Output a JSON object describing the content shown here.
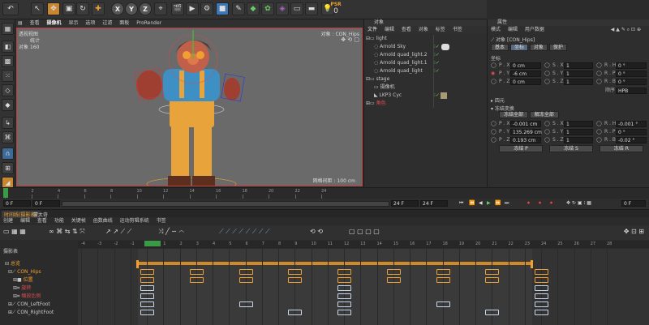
{
  "toolbar": {
    "psr_label": "PSR",
    "psr_value": "0",
    "xyz": [
      "X",
      "Y",
      "Z"
    ]
  },
  "viewport": {
    "menu": [
      "查看",
      "摄像机",
      "显示",
      "选项",
      "过滤",
      "面板",
      "ProRender"
    ],
    "mode_label": "透视视图",
    "stats": {
      "title": "统计",
      "row1_label": "对象",
      "row1_value": "160"
    },
    "camera": "对象 : CON_Hips",
    "grid": "网格间距 : 100 cm",
    "colors": {
      "bg": "#6a6a6a",
      "shirt": "#3e8fc4",
      "pants": "#e8a33a",
      "skin": "#c0604a",
      "hair": "#5b2e1e"
    }
  },
  "objects": {
    "menu": [
      "文件",
      "编辑",
      "查看",
      "对象",
      "标签",
      "书签"
    ],
    "header": "对象",
    "items": [
      "light",
      "Arnold Sky",
      "Arnold quad_light.2",
      "Arnold quad_light.1",
      "Arnold quad_light",
      "stage",
      "摄像机",
      "LKP3 Cyc",
      "角色"
    ]
  },
  "attributes": {
    "title": "属性",
    "menu": [
      "模式",
      "编辑",
      "用户数据"
    ],
    "object_name": "对象 [CON_Hips]",
    "tabs": [
      "基本",
      "坐标",
      "对象",
      "保护"
    ],
    "section": "坐标",
    "p": [
      {
        "axis": "P . X",
        "val": "0 cm"
      },
      {
        "axis": "P . Y",
        "val": "-6 cm"
      },
      {
        "axis": "P . Z",
        "val": "0 cm"
      }
    ],
    "s": [
      {
        "axis": "S . X",
        "val": "1"
      },
      {
        "axis": "S . Y",
        "val": "1"
      },
      {
        "axis": "S . Z",
        "val": "1"
      }
    ],
    "r": [
      {
        "axis": "R . H",
        "val": "0 °"
      },
      {
        "axis": "R . P",
        "val": "0 °"
      },
      {
        "axis": "R . B",
        "val": "0 °"
      }
    ],
    "order_label": "顺序",
    "order_value": "HPB",
    "quaternion": "四元",
    "frozen": "冻结变换",
    "freeze_all": "冻结全部",
    "unfreeze_all": "解冻全部",
    "fp": [
      {
        "axis": "P . X",
        "val": "-0.001 cm"
      },
      {
        "axis": "P . Y",
        "val": "135.269 cm"
      },
      {
        "axis": "P . Z",
        "val": "0.193 cm"
      }
    ],
    "fs": [
      {
        "axis": "S . X",
        "val": "1"
      },
      {
        "axis": "S . Y",
        "val": "1"
      },
      {
        "axis": "S . Z",
        "val": "1"
      }
    ],
    "fr": [
      {
        "axis": "R . H",
        "val": "-0.001 °"
      },
      {
        "axis": "R . P",
        "val": "0 °"
      },
      {
        "axis": "R . B",
        "val": "-0.02 °"
      }
    ],
    "freeze_p": "冻结 P",
    "freeze_s": "冻结 S",
    "freeze_r": "冻结 R"
  },
  "timeline": {
    "ticks": [
      "0",
      "2",
      "4",
      "6",
      "8",
      "10",
      "12",
      "14",
      "16",
      "18",
      "20",
      "22",
      "24"
    ],
    "start": "0 F",
    "start2": "0 F",
    "end": "24 F",
    "end2": "24 F",
    "current": "0 F"
  },
  "dopesheet": {
    "tabs": [
      "时间线(摄影表)",
      "蒙太奇"
    ],
    "menu": [
      "创建",
      "编辑",
      "查看",
      "功能",
      "关键帧",
      "函数曲线",
      "运动剪辑系统",
      "书签"
    ],
    "label": "摄影表",
    "ticks": [
      "-4",
      "-3",
      "-2",
      "-1",
      "0",
      "1",
      "2",
      "3",
      "4",
      "5",
      "6",
      "7",
      "8",
      "9",
      "10",
      "11",
      "12",
      "13",
      "14",
      "15",
      "16",
      "17",
      "18",
      "19",
      "20",
      "21",
      "22",
      "23",
      "24",
      "25",
      "26",
      "27",
      "28"
    ],
    "tracks": [
      "总览",
      "CON_Hips",
      "位置",
      "旋转",
      "缩放比例",
      "CON_LeftFoot",
      "CON_RightFoot"
    ]
  }
}
